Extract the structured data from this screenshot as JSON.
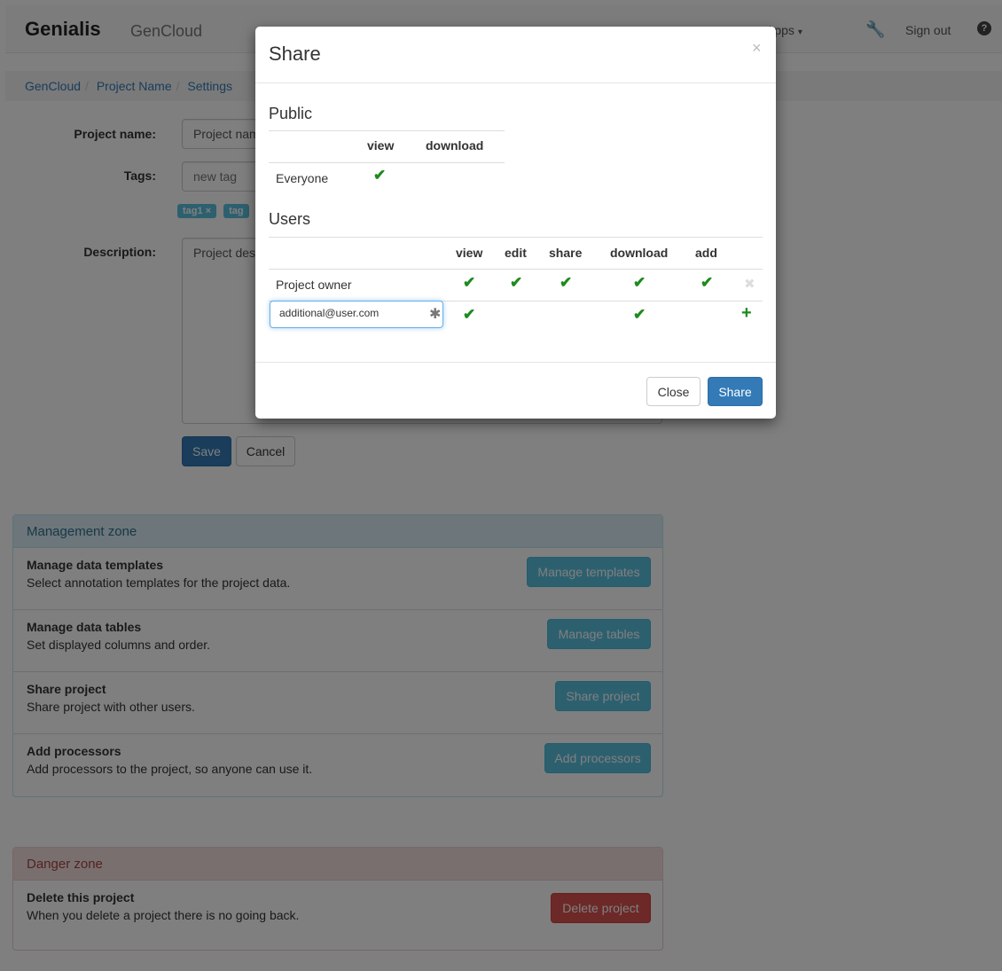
{
  "navbar": {
    "brand": "Genialis",
    "subtitle": "GenCloud",
    "apps_label": "Apps",
    "signout_label": "Sign out"
  },
  "breadcrumb": [
    "GenCloud",
    "Project Name",
    "Settings"
  ],
  "form": {
    "project_name_label": "Project name:",
    "project_name_value": "Project nam",
    "tags_label": "Tags:",
    "tags_placeholder": "new tag",
    "tags": [
      "tag1 ×",
      "tag"
    ],
    "description_label": "Description:",
    "description_value": "Project des",
    "save_label": "Save",
    "cancel_label": "Cancel"
  },
  "management_zone": {
    "title": "Management zone",
    "rows": [
      {
        "title": "Manage data templates",
        "desc": "Select annotation templates for the project data.",
        "button": "Manage templates"
      },
      {
        "title": "Manage data tables",
        "desc": "Set displayed columns and order.",
        "button": "Manage tables"
      },
      {
        "title": "Share project",
        "desc": "Share project with other users.",
        "button": "Share project"
      },
      {
        "title": "Add processors",
        "desc": "Add processors to the project, so anyone can use it.",
        "button": "Add processors"
      }
    ]
  },
  "danger_zone": {
    "title": "Danger zone",
    "row": {
      "title": "Delete this project",
      "desc": "When you delete a project there is no going back.",
      "button": "Delete project"
    }
  },
  "modal": {
    "title": "Share",
    "close_icon": "×",
    "public": {
      "title": "Public",
      "columns": [
        "view",
        "download"
      ],
      "rows": [
        {
          "name": "Everyone",
          "view": true,
          "download": false
        }
      ]
    },
    "users": {
      "title": "Users",
      "columns": [
        "view",
        "edit",
        "share",
        "download",
        "add"
      ],
      "rows": [
        {
          "name": "Project owner",
          "view": true,
          "edit": true,
          "share": true,
          "download": true,
          "add": true
        }
      ],
      "new_user": {
        "email": "additional@user.com",
        "view": true,
        "edit": false,
        "share": false,
        "download": true,
        "add": false
      }
    },
    "close_button": "Close",
    "share_button": "Share"
  },
  "colors": {
    "primary": "#337ab7",
    "info": "#5bc0de",
    "danger": "#d9534f",
    "check": "#1e8a1e"
  }
}
